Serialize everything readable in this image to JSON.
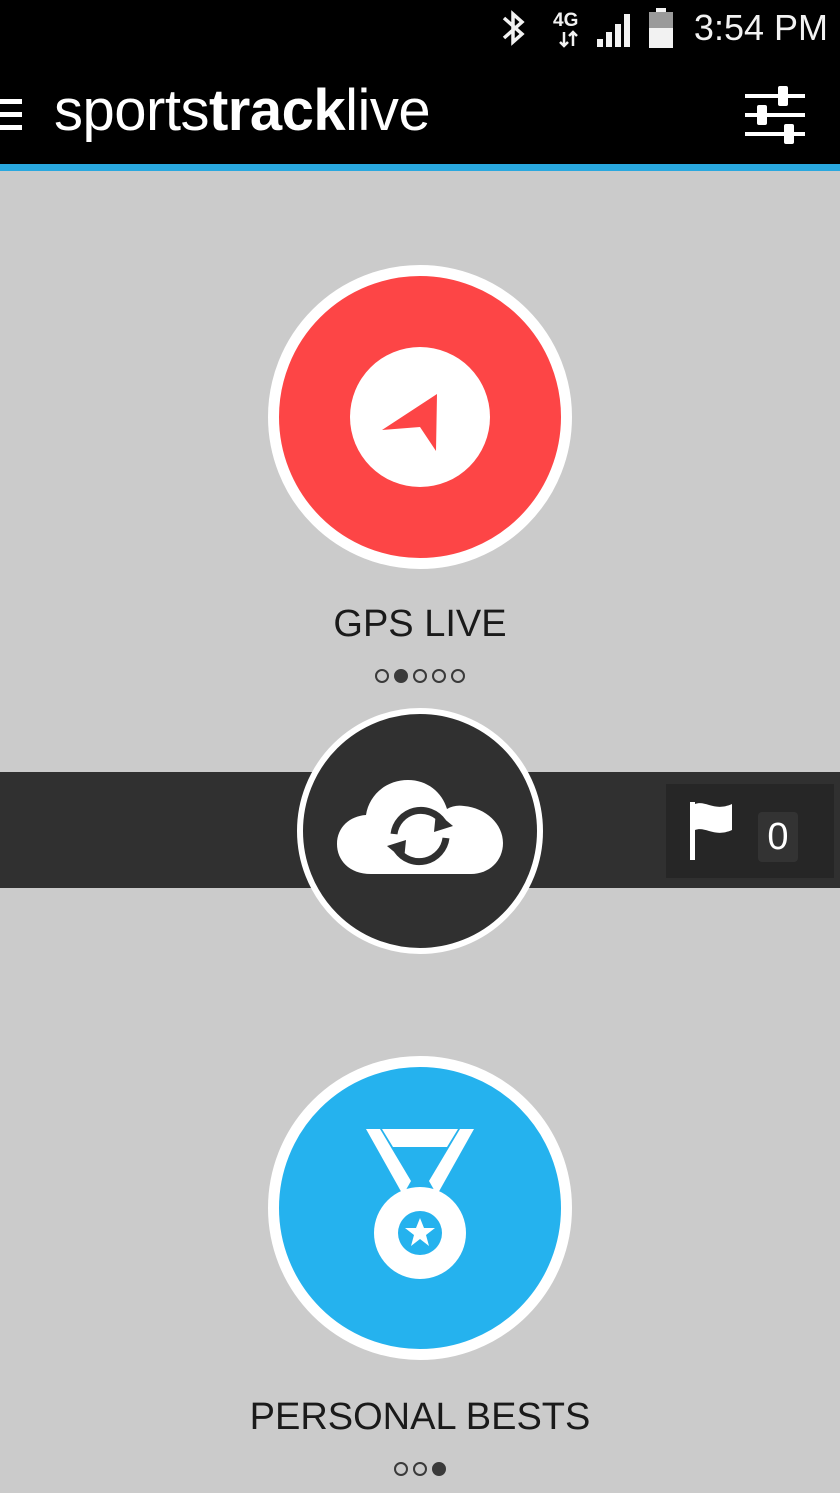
{
  "status_bar": {
    "time": "3:54 PM",
    "network_label": "4G",
    "icons": [
      "bluetooth-icon",
      "network-4g-icon",
      "signal-icon",
      "battery-icon"
    ]
  },
  "app_bar": {
    "title_regular_1": "sports",
    "title_bold": "track",
    "title_regular_2": "live",
    "icons": [
      "menu-icon",
      "settings-sliders-icon"
    ]
  },
  "gps_live": {
    "label": "GPS LIVE",
    "color": "#fd4546",
    "icon": "navigation-arrow-icon",
    "page_indicator": {
      "count": 5,
      "active_index": 1
    }
  },
  "sync": {
    "icon": "cloud-sync-icon"
  },
  "flags": {
    "icon": "flag-icon",
    "count": "0"
  },
  "personal_bests": {
    "label": "PERSONAL BESTS",
    "color": "#25b2ee",
    "icon": "medal-icon",
    "page_indicator": {
      "count": 3,
      "active_index": 2
    }
  },
  "colors": {
    "background": "#cbcbcb",
    "app_bar": "#000000",
    "accent": "#29a8df",
    "band": "#303030"
  }
}
